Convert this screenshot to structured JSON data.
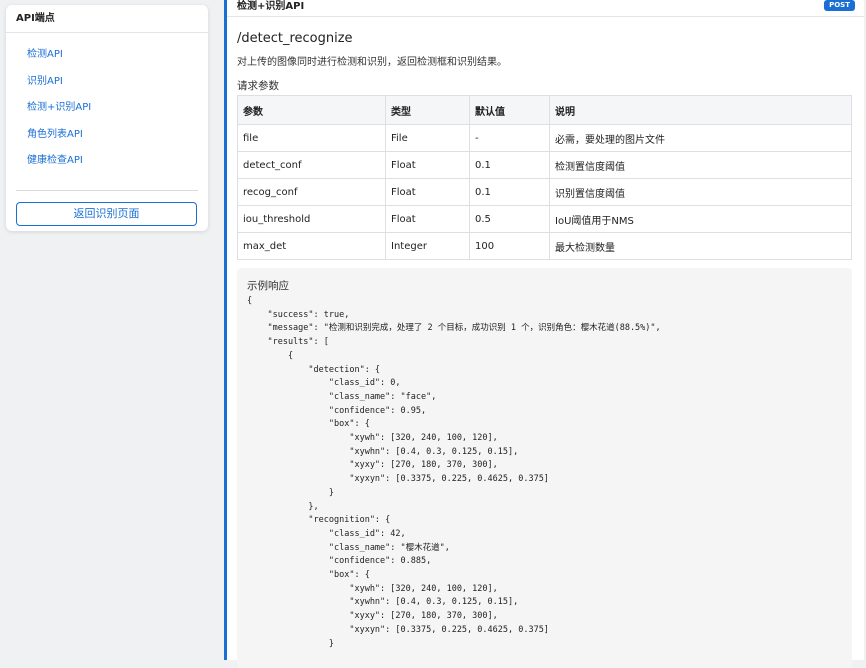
{
  "sidebar": {
    "title": "API端点",
    "items": [
      {
        "label": "检测API"
      },
      {
        "label": "识别API"
      },
      {
        "label": "检测+识别API"
      },
      {
        "label": "角色列表API"
      },
      {
        "label": "健康检查API"
      }
    ],
    "back_button": "返回识别页面"
  },
  "main": {
    "title": "检测+识别API",
    "method": "POST",
    "path": "/detect_recognize",
    "description": "对上传的图像同时进行检测和识别，返回检测框和识别结果。",
    "params_label": "请求参数",
    "table": {
      "headers": [
        "参数",
        "类型",
        "默认值",
        "说明"
      ],
      "rows": [
        [
          "file",
          "File",
          "-",
          "必需，要处理的图片文件"
        ],
        [
          "detect_conf",
          "Float",
          "0.1",
          "检测置信度阈值"
        ],
        [
          "recog_conf",
          "Float",
          "0.1",
          "识别置信度阈值"
        ],
        [
          "iou_threshold",
          "Float",
          "0.5",
          "IoU阈值用于NMS"
        ],
        [
          "max_det",
          "Integer",
          "100",
          "最大检测数量"
        ]
      ]
    },
    "response_label": "示例响应",
    "response_code": "{\n    \"success\": true,\n    \"message\": \"检测和识别完成，处理了 2 个目标，成功识别 1 个，识别角色：樱木花道(88.5%)\",\n    \"results\": [\n        {\n            \"detection\": {\n                \"class_id\": 0,\n                \"class_name\": \"face\",\n                \"confidence\": 0.95,\n                \"box\": {\n                    \"xywh\": [320, 240, 100, 120],\n                    \"xywhn\": [0.4, 0.3, 0.125, 0.15],\n                    \"xyxy\": [270, 180, 370, 300],\n                    \"xyxyn\": [0.3375, 0.225, 0.4625, 0.375]\n                }\n            },\n            \"recognition\": {\n                \"class_id\": 42,\n                \"class_name\": \"樱木花道\",\n                \"confidence\": 0.885,\n                \"box\": {\n                    \"xywh\": [320, 240, 100, 120],\n                    \"xywhn\": [0.4, 0.3, 0.125, 0.15],\n                    \"xyxy\": [270, 180, 370, 300],\n                    \"xyxyn\": [0.3375, 0.225, 0.4625, 0.375]\n                }"
  }
}
